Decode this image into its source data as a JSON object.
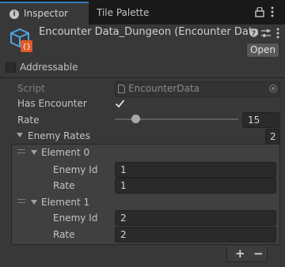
{
  "tabs": [
    {
      "label": "Inspector",
      "icon": "info-icon"
    },
    {
      "label": "Tile Palette"
    }
  ],
  "header": {
    "title": "Encounter Data_Dungeon (Encounter Data",
    "open_label": "Open",
    "asset_icon": "scriptable-object-icon"
  },
  "addressable": {
    "label": "Addressable",
    "checked": false
  },
  "fields": {
    "script": {
      "label": "Script",
      "value": "EncounterData"
    },
    "has_encounter": {
      "label": "Has Encounter",
      "checked": true
    },
    "rate": {
      "label": "Rate",
      "value": "15"
    }
  },
  "enemy_rates": {
    "label": "Enemy Rates",
    "size": "2",
    "elements": [
      {
        "label": "Element 0",
        "enemy_id_label": "Enemy Id",
        "enemy_id": "1",
        "rate_label": "Rate",
        "rate": "1"
      },
      {
        "label": "Element 1",
        "enemy_id_label": "Enemy Id",
        "enemy_id": "2",
        "rate_label": "Rate",
        "rate": "2"
      }
    ]
  },
  "list_buttons": {
    "add": "+",
    "remove": "−"
  }
}
